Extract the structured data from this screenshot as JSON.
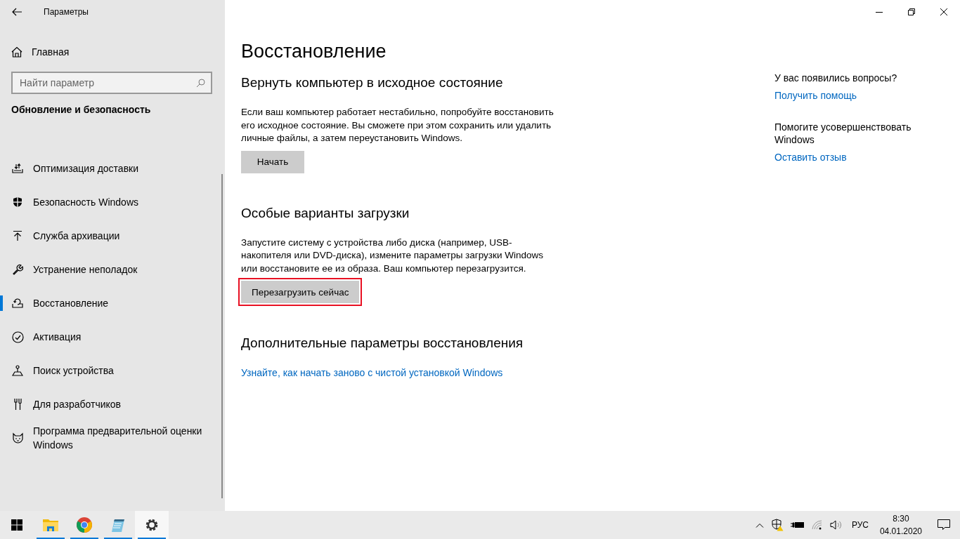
{
  "window": {
    "title": "Параметры"
  },
  "sidebar": {
    "home": "Главная",
    "search": {
      "placeholder": "Найти параметр"
    },
    "category": "Обновление и безопасность",
    "items": [
      {
        "kind": "delivery",
        "label": "Оптимизация доставки",
        "selected": false
      },
      {
        "kind": "shield",
        "label": "Безопасность Windows",
        "selected": false
      },
      {
        "kind": "backup",
        "label": "Служба архивации",
        "selected": false
      },
      {
        "kind": "wrench",
        "label": "Устранение неполадок",
        "selected": false
      },
      {
        "kind": "recovery",
        "label": "Восстановление",
        "selected": true
      },
      {
        "kind": "check",
        "label": "Активация",
        "selected": false
      },
      {
        "kind": "find",
        "label": "Поиск устройства",
        "selected": false
      },
      {
        "kind": "developer",
        "label": "Для разработчиков",
        "selected": false
      },
      {
        "kind": "insider",
        "label": "Программа предварительной оценки Windows",
        "selected": false
      }
    ]
  },
  "main": {
    "title": "Восстановление",
    "sections": [
      {
        "heading": "Вернуть компьютер в исходное состояние",
        "text": "Если ваш компьютер работает нестабильно, попробуйте восстановить его исходное состояние. Вы сможете при этом сохранить или удалить личные файлы, а затем переустановить Windows.",
        "button": {
          "label": "Начать",
          "highlighted": false
        }
      },
      {
        "heading": "Особые варианты загрузки",
        "text": "Запустите систему с устройства либо диска (например, USB-накопителя или DVD-диска), измените параметры загрузки Windows или восстановите ее из образа. Ваш компьютер перезагрузится.",
        "button": {
          "label": "Перезагрузить сейчас",
          "highlighted": true
        }
      },
      {
        "heading": "Дополнительные параметры восстановления",
        "link": "Узнайте, как начать заново с чистой установкой Windows"
      }
    ]
  },
  "aside": [
    {
      "question": "У вас появились вопросы?",
      "link": "Получить помощь"
    },
    {
      "question": "Помогите усовершенствовать Windows",
      "link": "Оставить отзыв"
    }
  ],
  "taskbar": {
    "apps": [
      {
        "kind": "explorer",
        "running": true,
        "active": false
      },
      {
        "kind": "browser",
        "running": true,
        "active": false
      },
      {
        "kind": "notepad",
        "running": true,
        "active": false
      },
      {
        "kind": "settings",
        "running": true,
        "active": true
      }
    ],
    "language": "РУС",
    "time": "8:30",
    "date": "04.01.2020"
  }
}
